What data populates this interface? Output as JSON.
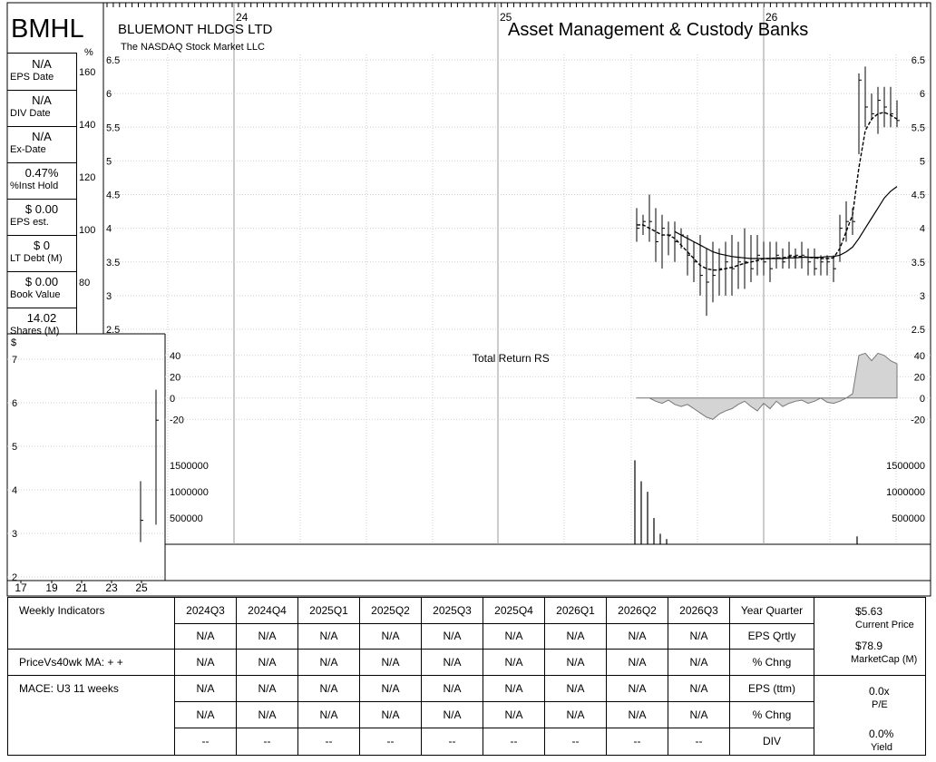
{
  "header": {
    "ticker": "BMHL",
    "company": "BLUEMONT HLDGS LTD",
    "exchange": "The NASDAQ Stock Market LLC",
    "industry": "Asset Management & Custody Banks"
  },
  "sidebar": [
    {
      "value": "N/A",
      "label": "EPS Date"
    },
    {
      "value": "N/A",
      "label": "DIV Date"
    },
    {
      "value": "N/A",
      "label": "Ex-Date"
    },
    {
      "value": "0.47%",
      "label": "%Inst Hold"
    },
    {
      "value": "$ 0.00",
      "label": "EPS est."
    },
    {
      "value": "$ 0",
      "label": "LT Debt (M)"
    },
    {
      "value": "$ 0.00",
      "label": "Book Value"
    },
    {
      "value": "14.02",
      "label": "Shares (M)"
    }
  ],
  "chart_data": [
    {
      "type": "line",
      "name": "price",
      "x_ticks": [
        "24",
        "25",
        "26"
      ],
      "ylim": [
        2.5,
        6.5
      ],
      "y_ticks": [
        2.5,
        3,
        3.5,
        4,
        4.5,
        5,
        5.5,
        6,
        6.5
      ],
      "pct_ticks": [
        "%",
        160,
        140,
        120,
        100,
        80
      ],
      "bars": [
        {
          "lo": 3.8,
          "hi": 4.3,
          "c": 4.0
        },
        {
          "lo": 3.9,
          "hi": 4.2,
          "c": 4.1
        },
        {
          "lo": 3.8,
          "hi": 4.5,
          "c": 4.1
        },
        {
          "lo": 3.5,
          "hi": 4.3,
          "c": 3.8
        },
        {
          "lo": 3.4,
          "hi": 4.2,
          "c": 4.0
        },
        {
          "lo": 3.6,
          "hi": 4.1,
          "c": 3.9
        },
        {
          "lo": 3.5,
          "hi": 4.1,
          "c": 3.8
        },
        {
          "lo": 3.7,
          "hi": 4.0,
          "c": 3.9
        },
        {
          "lo": 3.3,
          "hi": 3.9,
          "c": 3.6
        },
        {
          "lo": 3.2,
          "hi": 3.8,
          "c": 3.5
        },
        {
          "lo": 3.0,
          "hi": 3.9,
          "c": 3.3
        },
        {
          "lo": 2.7,
          "hi": 3.7,
          "c": 3.2
        },
        {
          "lo": 2.9,
          "hi": 3.8,
          "c": 3.3
        },
        {
          "lo": 3.0,
          "hi": 3.7,
          "c": 3.4
        },
        {
          "lo": 3.0,
          "hi": 3.8,
          "c": 3.5
        },
        {
          "lo": 3.0,
          "hi": 3.9,
          "c": 3.4
        },
        {
          "lo": 3.1,
          "hi": 3.8,
          "c": 3.5
        },
        {
          "lo": 3.1,
          "hi": 4.0,
          "c": 3.5
        },
        {
          "lo": 3.2,
          "hi": 3.9,
          "c": 3.4
        },
        {
          "lo": 3.3,
          "hi": 3.9,
          "c": 3.6
        },
        {
          "lo": 3.3,
          "hi": 3.8,
          "c": 3.5
        },
        {
          "lo": 3.2,
          "hi": 3.8,
          "c": 3.4
        },
        {
          "lo": 3.4,
          "hi": 3.8,
          "c": 3.6
        },
        {
          "lo": 3.4,
          "hi": 3.7,
          "c": 3.5
        },
        {
          "lo": 3.4,
          "hi": 3.8,
          "c": 3.6
        },
        {
          "lo": 3.4,
          "hi": 3.7,
          "c": 3.6
        },
        {
          "lo": 3.4,
          "hi": 3.8,
          "c": 3.6
        },
        {
          "lo": 3.3,
          "hi": 3.7,
          "c": 3.5
        },
        {
          "lo": 3.3,
          "hi": 3.7,
          "c": 3.4
        },
        {
          "lo": 3.3,
          "hi": 3.6,
          "c": 3.5
        },
        {
          "lo": 3.3,
          "hi": 3.6,
          "c": 3.5
        },
        {
          "lo": 3.2,
          "hi": 3.6,
          "c": 3.4
        },
        {
          "lo": 3.5,
          "hi": 4.2,
          "c": 4.0
        },
        {
          "lo": 3.8,
          "hi": 4.4,
          "c": 4.1
        },
        {
          "lo": 3.9,
          "hi": 4.3,
          "c": 4.1
        },
        {
          "lo": 5.1,
          "hi": 6.3,
          "c": 6.2
        },
        {
          "lo": 5.5,
          "hi": 6.4,
          "c": 5.8
        },
        {
          "lo": 5.6,
          "hi": 6.0,
          "c": 5.7
        },
        {
          "lo": 5.4,
          "hi": 6.1,
          "c": 5.9
        },
        {
          "lo": 5.5,
          "hi": 6.1,
          "c": 5.8
        },
        {
          "lo": 5.5,
          "hi": 6.1,
          "c": 5.7
        },
        {
          "lo": 5.5,
          "hi": 5.9,
          "c": 5.6
        }
      ],
      "series": [
        {
          "name": "",
          "values": [
            4.05,
            4.05,
            4.0,
            3.95,
            3.9,
            3.9,
            3.85,
            3.75,
            3.65,
            3.55,
            3.45,
            3.4,
            3.38,
            3.38,
            3.4,
            3.42,
            3.45,
            3.48,
            3.5,
            3.52,
            3.55,
            3.55,
            3.56,
            3.56,
            3.58,
            3.58,
            3.58,
            3.57,
            3.56,
            3.55,
            3.55,
            3.56,
            3.7,
            3.95,
            4.2,
            4.9,
            5.45,
            5.62,
            5.7,
            5.72,
            5.68,
            5.62
          ]
        },
        {
          "name": "",
          "values": [
            null,
            null,
            null,
            null,
            null,
            null,
            3.95,
            3.9,
            3.85,
            3.8,
            3.75,
            3.7,
            3.65,
            3.62,
            3.6,
            3.58,
            3.57,
            3.56,
            3.55,
            3.55,
            3.55,
            3.55,
            3.55,
            3.55,
            3.56,
            3.56,
            3.57,
            3.57,
            3.57,
            3.57,
            3.58,
            3.58,
            3.6,
            3.65,
            3.72,
            3.85,
            4.0,
            4.15,
            4.3,
            4.45,
            4.55,
            4.62
          ]
        }
      ]
    },
    {
      "type": "area",
      "name": "rs",
      "title": "Total Return RS",
      "ylim": [
        -30,
        50
      ],
      "y_ticks": [
        40,
        20,
        0,
        -20
      ],
      "values": [
        0,
        0,
        0,
        -3,
        -5,
        -2,
        -6,
        -8,
        -6,
        -10,
        -14,
        -18,
        -20,
        -15,
        -12,
        -10,
        -6,
        -3,
        -8,
        -12,
        -5,
        -10,
        -3,
        -8,
        -5,
        -3,
        -2,
        -5,
        -3,
        0,
        -4,
        -5,
        -3,
        0,
        4,
        40,
        42,
        35,
        42,
        40,
        35,
        32
      ]
    },
    {
      "type": "bar",
      "name": "volume",
      "ylim": [
        0,
        1900000
      ],
      "y_ticks": [
        1500000,
        1000000,
        500000
      ],
      "values": [
        1600000,
        1200000,
        1000000,
        500000,
        200000,
        100000,
        0,
        0,
        0,
        0,
        0,
        0,
        0,
        0,
        0,
        0,
        0,
        0,
        0,
        0,
        0,
        0,
        0,
        0,
        0,
        0,
        0,
        0,
        0,
        0,
        0,
        0,
        0,
        0,
        0,
        150000,
        0,
        0,
        0,
        0,
        0,
        0
      ]
    },
    {
      "type": "line",
      "name": "mini",
      "y_label": "$",
      "ylim": [
        2,
        7.5
      ],
      "y_ticks": [
        2,
        3,
        4,
        5,
        6,
        7
      ],
      "x_ticks": [
        "17",
        "19",
        "21",
        "23",
        "25"
      ],
      "bars": [
        {
          "lo": 2.8,
          "hi": 4.2,
          "c": 3.3
        },
        {
          "lo": 3.2,
          "hi": 6.3,
          "c": 5.6
        }
      ]
    }
  ],
  "indicators": {
    "quarters": [
      "2024Q3",
      "2024Q4",
      "2025Q1",
      "2025Q2",
      "2025Q3",
      "2025Q4",
      "2026Q1",
      "2026Q2",
      "2026Q3"
    ],
    "rows": [
      {
        "label": "Weekly Indicators",
        "cells": [
          "2024Q3",
          "2024Q4",
          "2025Q1",
          "2025Q2",
          "2025Q3",
          "2025Q4",
          "2026Q1",
          "2026Q2",
          "2026Q3"
        ],
        "right": "Year Quarter"
      },
      {
        "label": "",
        "cells": [
          "N/A",
          "N/A",
          "N/A",
          "N/A",
          "N/A",
          "N/A",
          "N/A",
          "N/A",
          "N/A"
        ],
        "right": "EPS Qrtly"
      },
      {
        "label": "PriceVs40wk MA:  + +",
        "cells": [
          "N/A",
          "N/A",
          "N/A",
          "N/A",
          "N/A",
          "N/A",
          "N/A",
          "N/A",
          "N/A"
        ],
        "right": "% Chng"
      },
      {
        "label": "MACE: U3  11 weeks",
        "cells": [
          "N/A",
          "N/A",
          "N/A",
          "N/A",
          "N/A",
          "N/A",
          "N/A",
          "N/A",
          "N/A"
        ],
        "right": "EPS (ttm)"
      },
      {
        "label": "",
        "cells": [
          "N/A",
          "N/A",
          "N/A",
          "N/A",
          "N/A",
          "N/A",
          "N/A",
          "N/A",
          "N/A"
        ],
        "right": "% Chng"
      },
      {
        "label": "",
        "cells": [
          "--",
          "--",
          "--",
          "--",
          "--",
          "--",
          "--",
          "--",
          "--"
        ],
        "right": "DIV"
      }
    ],
    "summary": {
      "current_price": "$5.63",
      "current_price_label": "Current Price",
      "market_cap": "$78.9",
      "market_cap_label": "MarketCap (M)",
      "pe": "0.0x",
      "pe_label": "P/E",
      "yield": "0.0%",
      "yield_label": "Yield"
    }
  }
}
